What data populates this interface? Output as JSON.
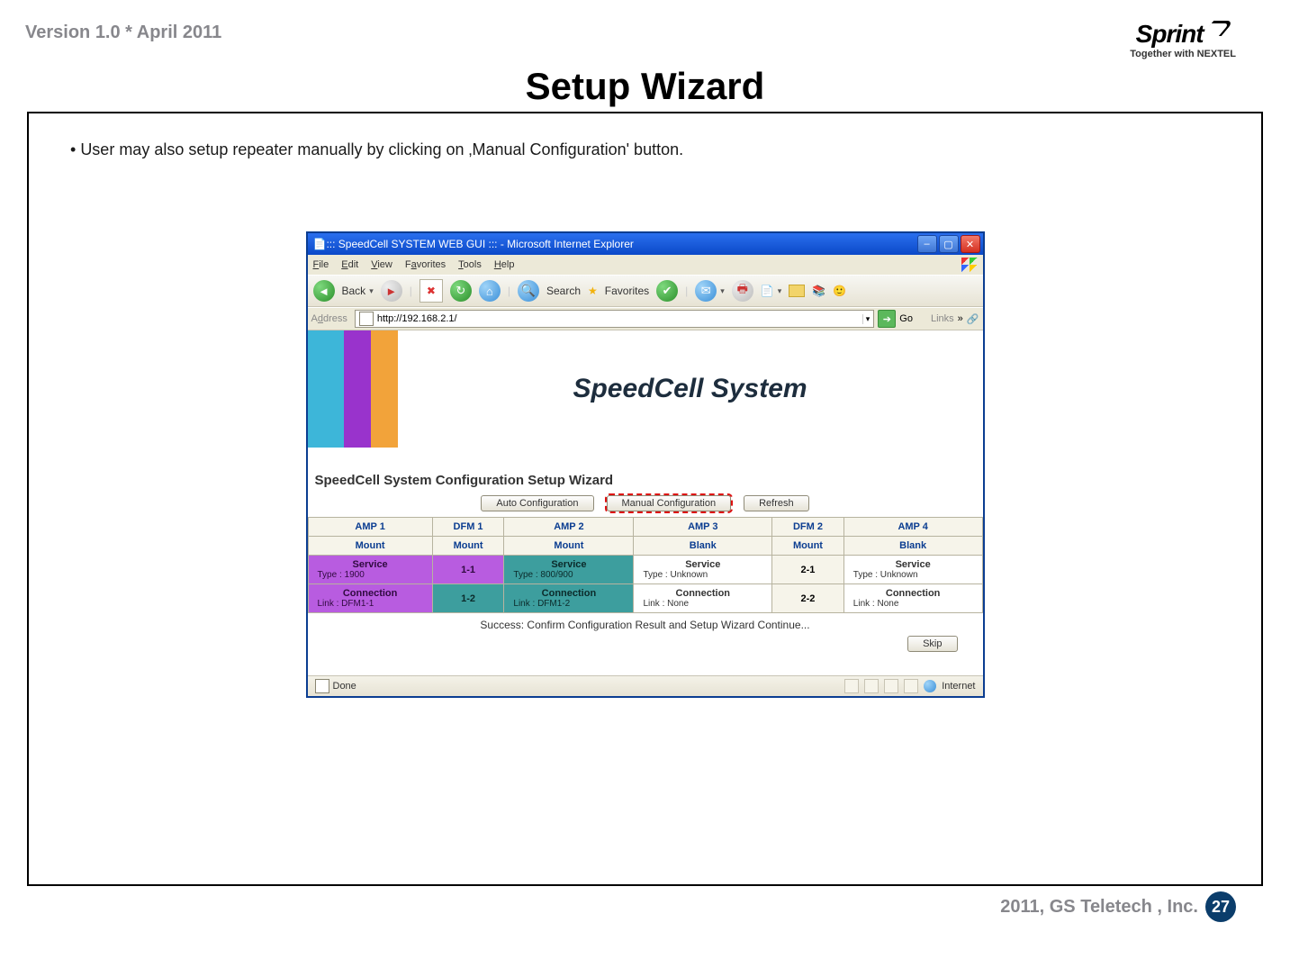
{
  "header": {
    "version": "Version 1.0 * April 2011",
    "brand": "Sprint",
    "brand_tag": "Together with NEXTEL"
  },
  "slide": {
    "title": "Setup Wizard",
    "bullet": "User may also setup repeater manually by clicking on ‚Manual Configuration' button."
  },
  "ie": {
    "title": "::: SpeedCell SYSTEM WEB GUI ::: - Microsoft Internet Explorer",
    "menus": {
      "file": "File",
      "edit": "Edit",
      "view": "View",
      "favorites": "Favorites",
      "tools": "Tools",
      "help": "Help"
    },
    "toolbar": {
      "back": "Back",
      "search": "Search",
      "favorites": "Favorites"
    },
    "address_label": "Address",
    "url": "http://192.168.2.1/",
    "go": "Go",
    "links": "Links",
    "banner_title": "SpeedCell System",
    "wizard": {
      "title": "SpeedCell System Configuration Setup Wizard",
      "btn_auto": "Auto Configuration",
      "btn_manual": "Manual Configuration",
      "btn_refresh": "Refresh",
      "btn_skip": "Skip",
      "cols": {
        "amp1": "AMP 1",
        "dfm1": "DFM 1",
        "amp2": "AMP 2",
        "amp3": "AMP 3",
        "dfm2": "DFM 2",
        "amp4": "AMP 4"
      },
      "mount": "Mount",
      "blank": "Blank",
      "dfm": {
        "d11": "1-1",
        "d12": "1-2",
        "d21": "2-1",
        "d22": "2-2"
      },
      "svc_label": "Service",
      "conn_label": "Connection",
      "cells": {
        "amp1_type": "Type : 1900",
        "amp1_conn": "Link : DFM1-1",
        "amp2_type": "Type : 800/900",
        "amp2_conn": "Link : DFM1-2",
        "amp3_type": "Type : Unknown",
        "amp3_conn": "Link : None",
        "amp4_type": "Type : Unknown",
        "amp4_conn": "Link : None"
      },
      "success": "Success: Confirm Configuration Result and Setup Wizard Continue..."
    },
    "status": {
      "done": "Done",
      "zone": "Internet"
    }
  },
  "footer": {
    "copyright": "2011, GS Teletech , Inc.",
    "page": "27"
  }
}
